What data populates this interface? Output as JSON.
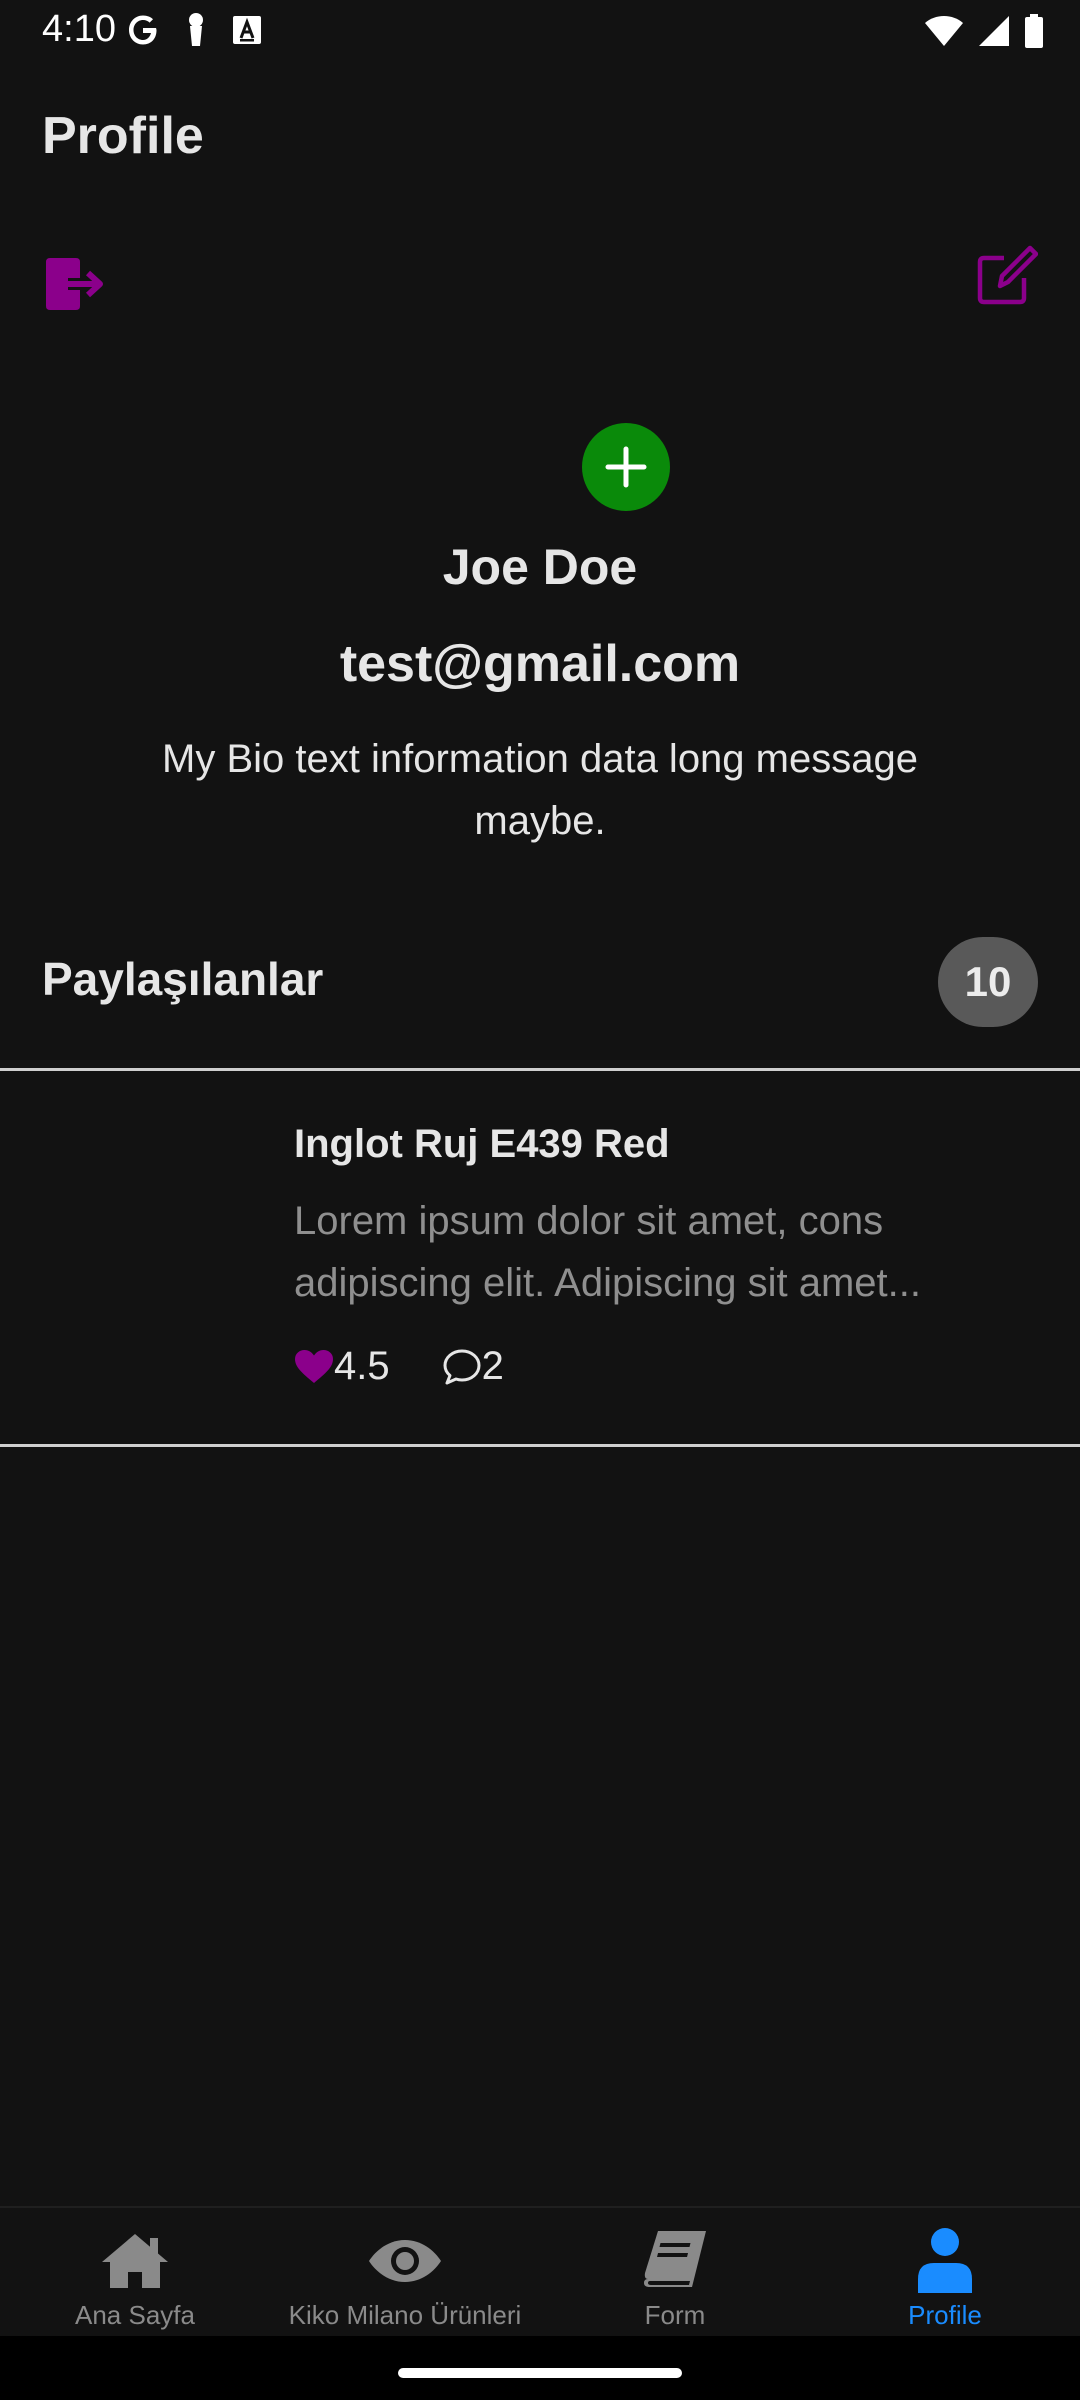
{
  "status_bar": {
    "time": "4:10",
    "left_icons": [
      "google-icon",
      "keyhole-icon",
      "font-a-icon"
    ],
    "right_icons": [
      "wifi-icon",
      "signal-icon",
      "battery-icon"
    ]
  },
  "header": {
    "title": "Profile",
    "logout_icon": "logout-icon",
    "edit_icon": "edit-icon",
    "accent_color": "#8b008b"
  },
  "profile": {
    "add_photo_icon": "plus-icon",
    "add_photo_color": "#0a8a0a",
    "name": "Joe Doe",
    "email": "test@gmail.com",
    "bio": "My Bio text information data long message maybe."
  },
  "shared": {
    "title": "Paylaşılanlar",
    "count": "10"
  },
  "posts": [
    {
      "title": "Inglot Ruj E439 Red",
      "description": "Lorem ipsum dolor sit amet, cons adipiscing elit. Adipiscing sit amet...",
      "rating": "4.5",
      "comments": "2",
      "rating_icon": "heart-icon",
      "comment_icon": "comment-icon"
    }
  ],
  "bottom_nav": {
    "items": [
      {
        "label": "Ana Sayfa",
        "icon": "home-icon"
      },
      {
        "label": "Kiko Milano Ürünleri",
        "icon": "eye-icon"
      },
      {
        "label": "Form",
        "icon": "book-icon"
      },
      {
        "label": "Profile",
        "icon": "user-icon"
      }
    ],
    "active_index": 3,
    "active_color": "#1a8cff",
    "inactive_color": "#8a8a8a"
  }
}
